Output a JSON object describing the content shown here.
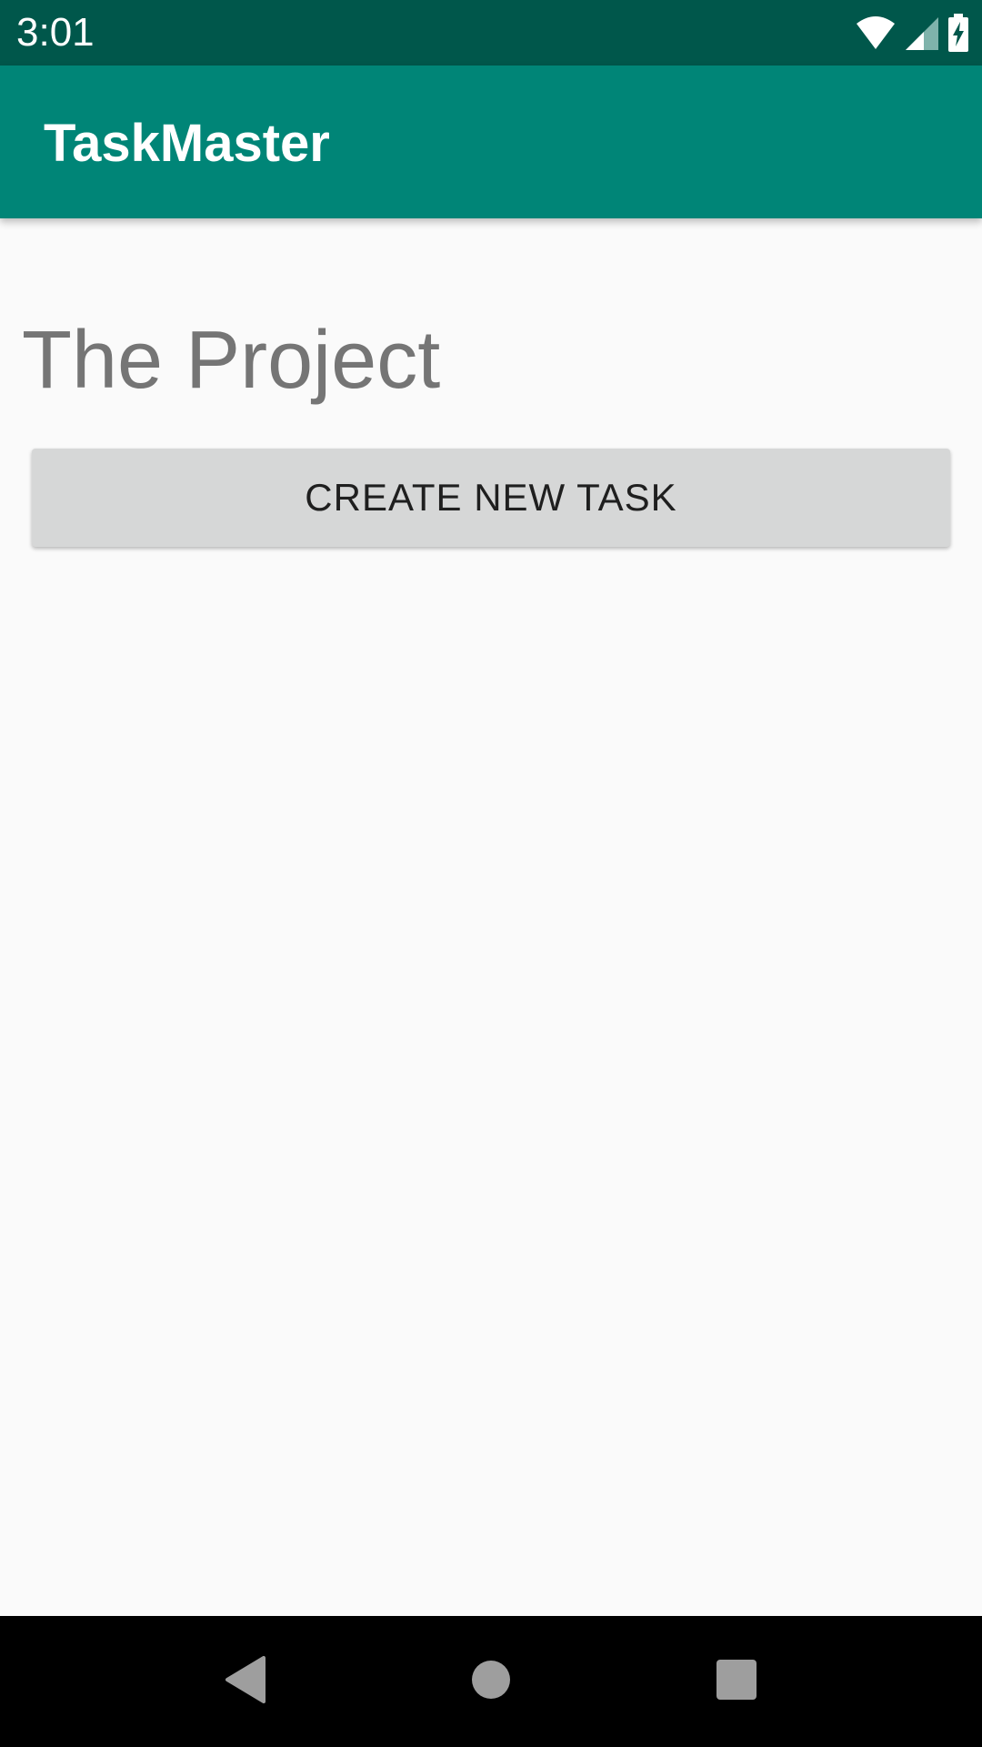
{
  "status_bar": {
    "time": "3:01",
    "icons": [
      "wifi-icon",
      "cellular-signal-icon",
      "battery-charging-icon"
    ],
    "background": "#00574b"
  },
  "app_bar": {
    "title": "TaskMaster",
    "background": "#008577"
  },
  "main": {
    "project_title": "The Project",
    "create_button_label": "CREATE NEW TASK",
    "background": "#fafafa"
  },
  "nav_bar": {
    "buttons": [
      "back-icon",
      "home-icon",
      "recents-icon"
    ],
    "background": "#000000"
  }
}
